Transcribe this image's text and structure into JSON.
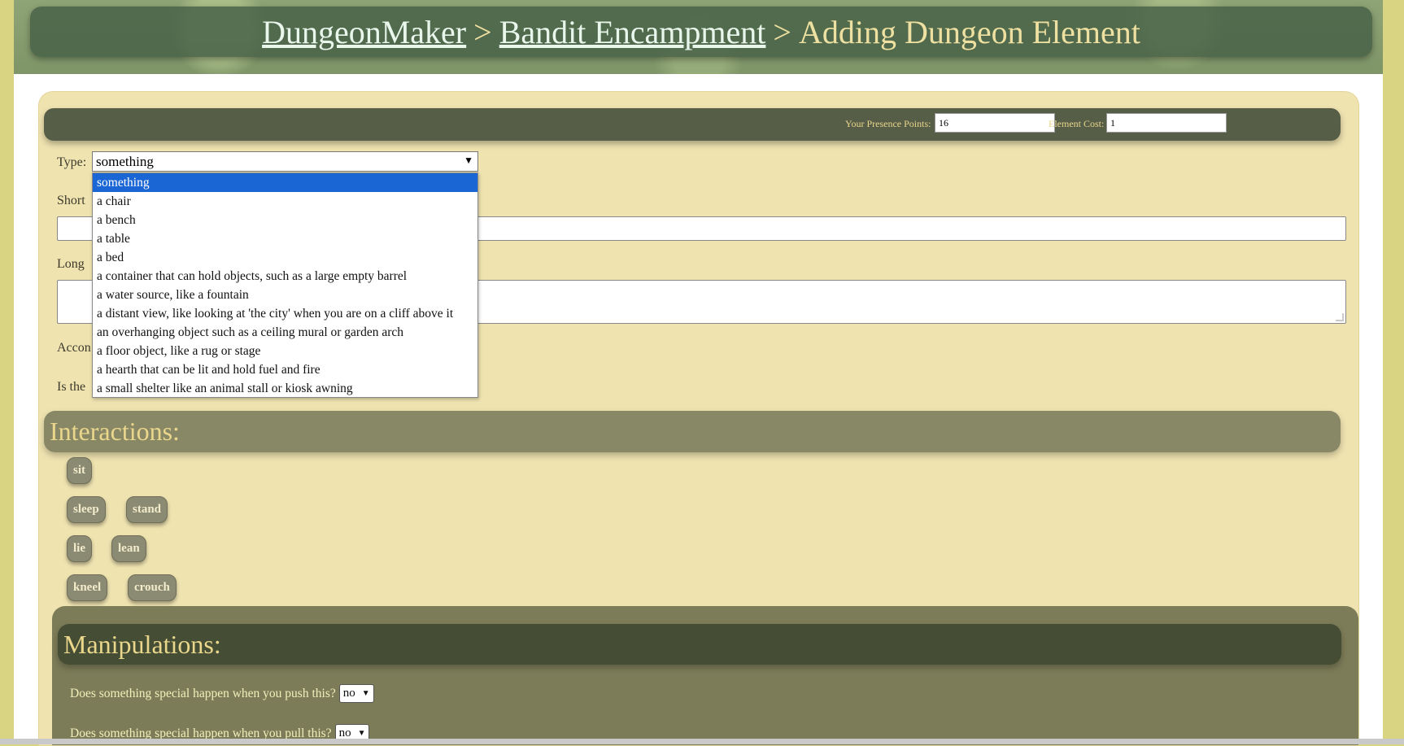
{
  "breadcrumb": {
    "site": "DungeonMaker",
    "sep1": ">",
    "dungeon": "Bandit Encampment ",
    "sep2": ">",
    "page": "Adding Dungeon Element"
  },
  "points": {
    "presence_label": "Your Presence Points:",
    "presence_value": "16",
    "cost_label": "Element Cost:",
    "cost_value": "1"
  },
  "form": {
    "type_label": "Type:",
    "type_value": "something",
    "short_label": "Short",
    "long_label": "Long",
    "accom_label": "Accon",
    "isthe_label": "Is the"
  },
  "type_options": [
    "something",
    "a chair",
    "a bench",
    "a table",
    "a bed",
    "a container that can hold objects, such as a large empty barrel",
    "a water source, like a fountain",
    "a distant view, like looking at 'the city' when you are on a cliff above it",
    "an overhanging object such as a ceiling mural or garden arch",
    "a floor object, like a rug or stage",
    "a hearth that can be lit and hold fuel and fire",
    "a small shelter like an animal stall or kiosk awning"
  ],
  "interactions": {
    "title": "Interactions:",
    "buttons": [
      "sit",
      "sleep",
      "stand",
      "lie",
      "lean",
      "kneel",
      "crouch"
    ]
  },
  "manipulations": {
    "title": "Manipulations:",
    "push_question": "Does something special happen when you push this?",
    "push_value": "no",
    "pull_question": "Does something special happen when you pull this?",
    "pull_value": "no"
  },
  "colors": {
    "accent_text": "#ead78c",
    "selected_option": "#1a66d4",
    "panel_bg": "#efe3b0"
  }
}
